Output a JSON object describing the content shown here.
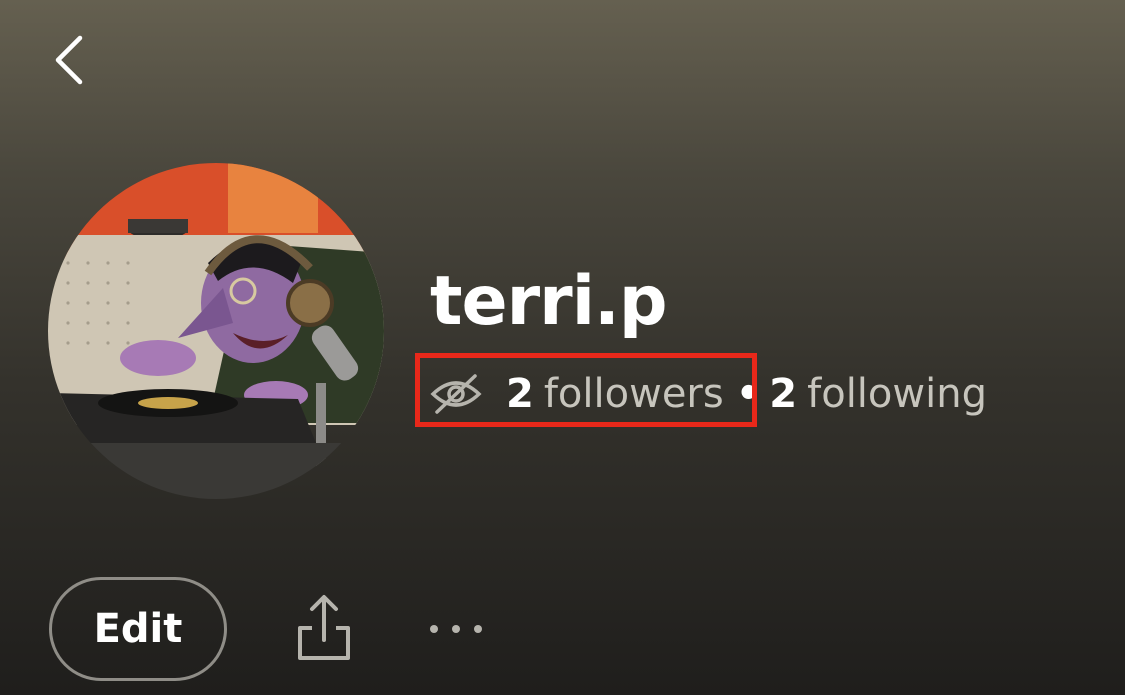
{
  "profile": {
    "username": "terri.p",
    "followers_count": "2",
    "followers_label": "followers",
    "separator": "•",
    "following_count": "2",
    "following_label": "following",
    "visibility_icon": "eye-slash-icon"
  },
  "actions": {
    "edit_label": "Edit",
    "share_icon": "share-icon",
    "more_icon": "more-options-icon",
    "back_icon": "chevron-left-icon"
  },
  "annotation": {
    "highlight_color": "#e8281a"
  },
  "colors": {
    "background_top": "#656050",
    "background_bottom": "#1f1e1c",
    "text_primary": "#ffffff",
    "text_secondary": "#c7c5bd"
  }
}
